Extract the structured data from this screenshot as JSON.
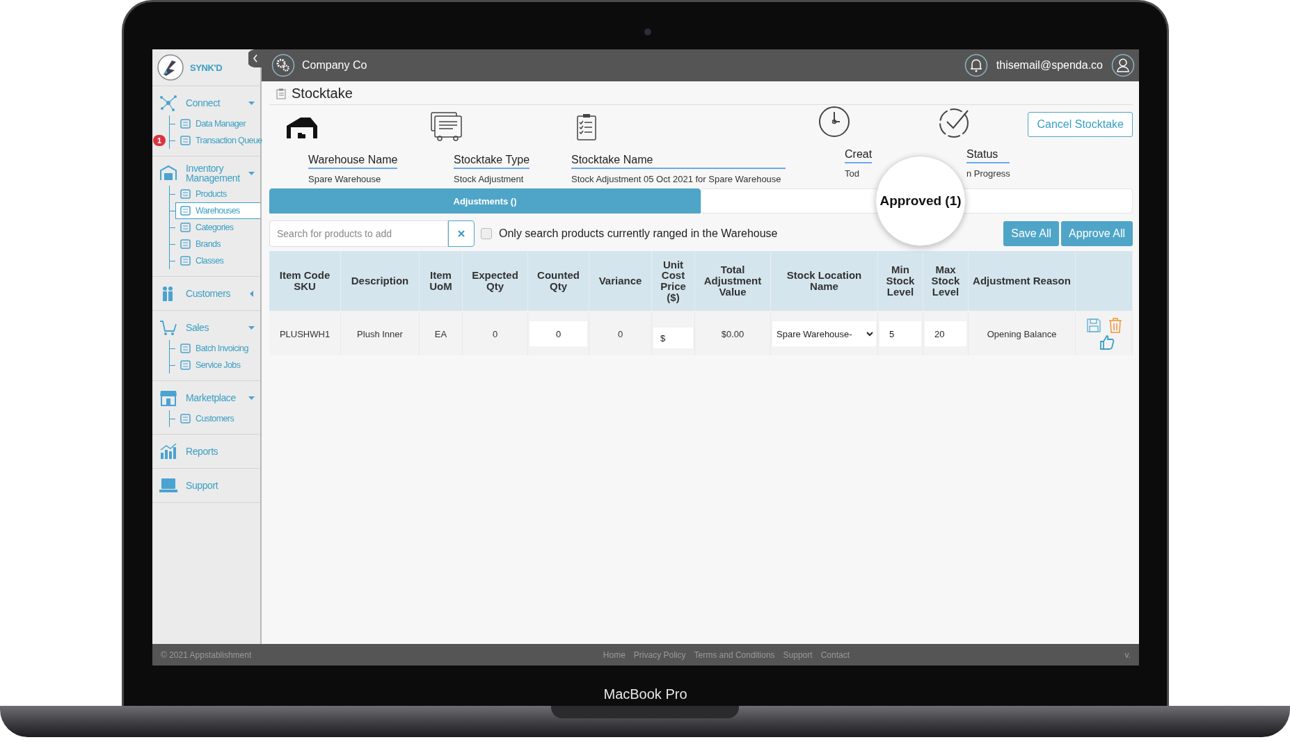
{
  "laptop": {
    "model_label": "MacBook Pro"
  },
  "sidebar": {
    "brand": "SYNK'D",
    "sections": [
      {
        "label": "Connect",
        "expanded": true,
        "children": [
          {
            "label": "Data Manager",
            "selected": false
          },
          {
            "label": "Transaction Queue",
            "badge": "1",
            "selected": false
          }
        ]
      },
      {
        "label": "Inventory Management",
        "expanded": true,
        "children": [
          {
            "label": "Products",
            "selected": false
          },
          {
            "label": "Warehouses",
            "selected": true
          },
          {
            "label": "Categories",
            "selected": false
          },
          {
            "label": "Brands",
            "selected": false
          },
          {
            "label": "Classes",
            "selected": false
          }
        ]
      },
      {
        "label": "Customers",
        "expanded": false
      },
      {
        "label": "Sales",
        "expanded": true,
        "children": [
          {
            "label": "Batch Invoicing",
            "selected": false
          },
          {
            "label": "Service Jobs",
            "selected": false
          }
        ]
      },
      {
        "label": "Marketplace",
        "expanded": true,
        "children": [
          {
            "label": "Customers",
            "selected": false
          }
        ]
      },
      {
        "label": "Reports"
      },
      {
        "label": "Support"
      }
    ]
  },
  "header": {
    "company": "Company Co",
    "user_email": "thisemail@spenda.co"
  },
  "page": {
    "title": "Stocktake",
    "cancel_button": "Cancel Stocktake",
    "info": [
      {
        "label": "Warehouse Name",
        "value": "Spare Warehouse"
      },
      {
        "label": "Stocktake Type",
        "value": "Stock Adjustment"
      },
      {
        "label": "Stocktake Name",
        "value": "Stock Adjustment 05 Oct 2021 for Spare Warehouse"
      },
      {
        "label": "Creat",
        "value": "Tod"
      },
      {
        "label": "Status",
        "value": "n Progress"
      }
    ]
  },
  "tabs": [
    {
      "label": "Adjustments ()",
      "selected": true
    },
    {
      "label": "Approved (1)",
      "selected": false
    }
  ],
  "search": {
    "placeholder": "Search for products to add"
  },
  "ranged_only": {
    "label": "Only search products currently ranged in the Warehouse",
    "checked": false
  },
  "buttons": [
    "Save All",
    "Approve All"
  ],
  "table": {
    "columns": [
      "Item Code SKU",
      "Description",
      "Item UoM",
      "Expected Qty",
      "Counted Qty",
      "Variance",
      "Unit Cost Price ($)",
      "Total Adjustment Value",
      "Stock Location Name",
      "Min Stock Level",
      "Max Stock Level",
      "Adjustment Reason"
    ],
    "rows": [
      {
        "sku": "PLUSHWH1",
        "description": "Plush Inner",
        "uom": "EA",
        "expected_qty": "0",
        "counted_qty": "0",
        "variance": "0",
        "unit_cost_currency": "$",
        "total_value": "$0.00",
        "stock_location": "Spare Warehouse-",
        "min_level": "5",
        "max_level": "20",
        "reason": "Opening Balance"
      }
    ]
  },
  "footer": {
    "copyright": "© 2021 Appstablishment",
    "links": [
      "Home",
      "Privacy Policy",
      "Terms and Conditions",
      "Support",
      "Contact"
    ],
    "version": "v."
  }
}
